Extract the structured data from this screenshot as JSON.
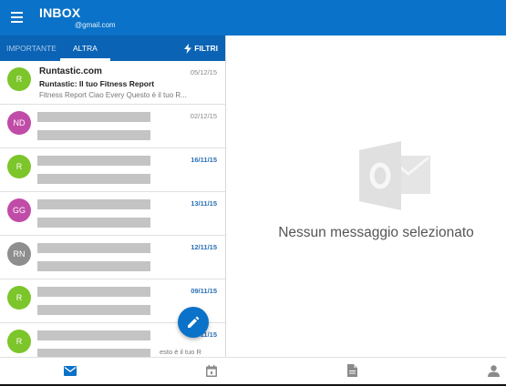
{
  "header": {
    "title": "INBOX",
    "account": "@gmail.com"
  },
  "tabs": {
    "importante": "IMPORTANTE",
    "altra": "ALTRA",
    "filter_label": "FILTRI"
  },
  "messages": [
    {
      "initials": "R",
      "avatar_color": "#7cc52a",
      "sender": "Runtastic.com",
      "subject": "Runtastic: Il tuo Fitness Report",
      "preview": "Fitness Report Ciao Every  Questo è il tuo R...",
      "date": "05/12/15",
      "date_unread": false
    },
    {
      "initials": "ND",
      "avatar_color": "#c04ca8",
      "date": "02/12/15",
      "date_unread": false
    },
    {
      "initials": "R",
      "avatar_color": "#7cc52a",
      "date": "16/11/15",
      "date_unread": true
    },
    {
      "initials": "GG",
      "avatar_color": "#c04ca8",
      "date": "13/11/15",
      "date_unread": true
    },
    {
      "initials": "RN",
      "avatar_color": "#8e8e8e",
      "date": "12/11/15",
      "date_unread": true
    },
    {
      "initials": "R",
      "avatar_color": "#7cc52a",
      "date": "09/11/15",
      "date_unread": true
    },
    {
      "initials": "R",
      "avatar_color": "#7cc52a",
      "date": "11/15",
      "date_unread": true,
      "partial_preview": "esto è il tuo R"
    }
  ],
  "detail": {
    "empty_message": "Nessun messaggio selezionato"
  },
  "bottom_nav": [
    "mail-icon",
    "calendar-icon",
    "files-icon",
    "people-icon"
  ],
  "colors": {
    "accent": "#0a72c8",
    "tabbar": "#0a63b4",
    "unread_date": "#2a6fb5"
  }
}
